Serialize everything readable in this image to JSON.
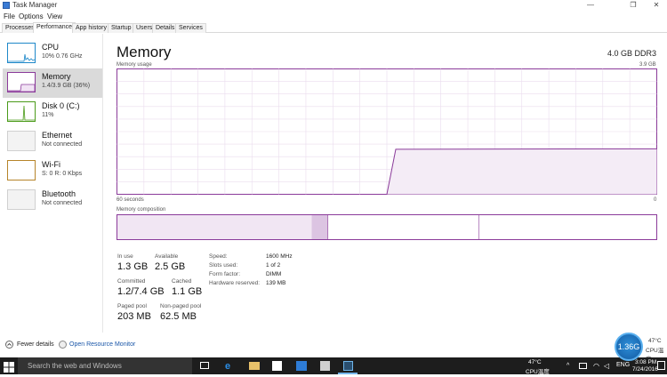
{
  "window": {
    "title": "Task Manager",
    "controls": [
      "—",
      "❐",
      "✕"
    ]
  },
  "menu": {
    "file": "File",
    "options": "Options",
    "view": "View"
  },
  "tabs": [
    {
      "label": "Processes",
      "active": false
    },
    {
      "label": "Performance",
      "active": true
    },
    {
      "label": "App history",
      "active": false
    },
    {
      "label": "Startup",
      "active": false
    },
    {
      "label": "Users",
      "active": false
    },
    {
      "label": "Details",
      "active": false
    },
    {
      "label": "Services",
      "active": false
    }
  ],
  "sidebar": {
    "items": [
      {
        "name": "CPU",
        "sub": "10% 0.76 GHz",
        "color": "#1e88c9",
        "active": false
      },
      {
        "name": "Memory",
        "sub": "1.4/3.9 GB (36%)",
        "color": "#8b3b9a",
        "active": true
      },
      {
        "name": "Disk 0 (C:)",
        "sub": "11%",
        "color": "#4b9b1a",
        "active": false
      },
      {
        "name": "Ethernet",
        "sub": "Not connected",
        "color": "#c2c2c2",
        "active": false
      },
      {
        "name": "Wi-Fi",
        "sub": "S: 0 R: 0 Kbps",
        "color": "#b6842a",
        "active": false
      },
      {
        "name": "Bluetooth",
        "sub": "Not connected",
        "color": "#c2c2c2",
        "active": false
      }
    ]
  },
  "header": {
    "title": "Memory",
    "spec": "4.0 GB DDR3"
  },
  "graph": {
    "label": "Memory usage",
    "max_label": "3.9 GB",
    "x_left_label": "60 seconds",
    "x_right_label": "0",
    "color": "#8b3b9a",
    "fill": "#f4ecf6",
    "usage_gb": 1.4,
    "max_gb": 3.9,
    "active_start_seconds_ago": 30
  },
  "composition": {
    "label": "Memory composition",
    "in_use_fraction": 0.36,
    "modified_fraction": 0.05,
    "standby_fraction": 0.28
  },
  "stats": {
    "in_use": {
      "label": "In use",
      "value": "1.3 GB"
    },
    "available": {
      "label": "Available",
      "value": "2.5 GB"
    },
    "committed": {
      "label": "Committed",
      "value": "1.2/7.4 GB"
    },
    "cached": {
      "label": "Cached",
      "value": "1.1 GB"
    },
    "paged_pool": {
      "label": "Paged pool",
      "value": "203 MB"
    },
    "non_paged_pool": {
      "label": "Non-paged pool",
      "value": "62.5 MB"
    }
  },
  "details": [
    {
      "key": "Speed:",
      "value": "1600 MHz"
    },
    {
      "key": "Slots used:",
      "value": "1 of 2"
    },
    {
      "key": "Form factor:",
      "value": "DIMM"
    },
    {
      "key": "Hardware reserved:",
      "value": "139 MB"
    }
  ],
  "footer": {
    "fewer_details": "Fewer details",
    "open_monitor": "Open Resource Monitor"
  },
  "overlay": {
    "badge_text": "1.36G",
    "temp": "47°C",
    "cpu_temp_label": "CPU温度"
  },
  "taskbar": {
    "search_placeholder": "Search the web and Windows",
    "tray_temp": "47°C",
    "tray_cpu_label": "CPU温度",
    "lang": "ENG",
    "time": "3:08 PM",
    "date": "7/24/2016"
  }
}
